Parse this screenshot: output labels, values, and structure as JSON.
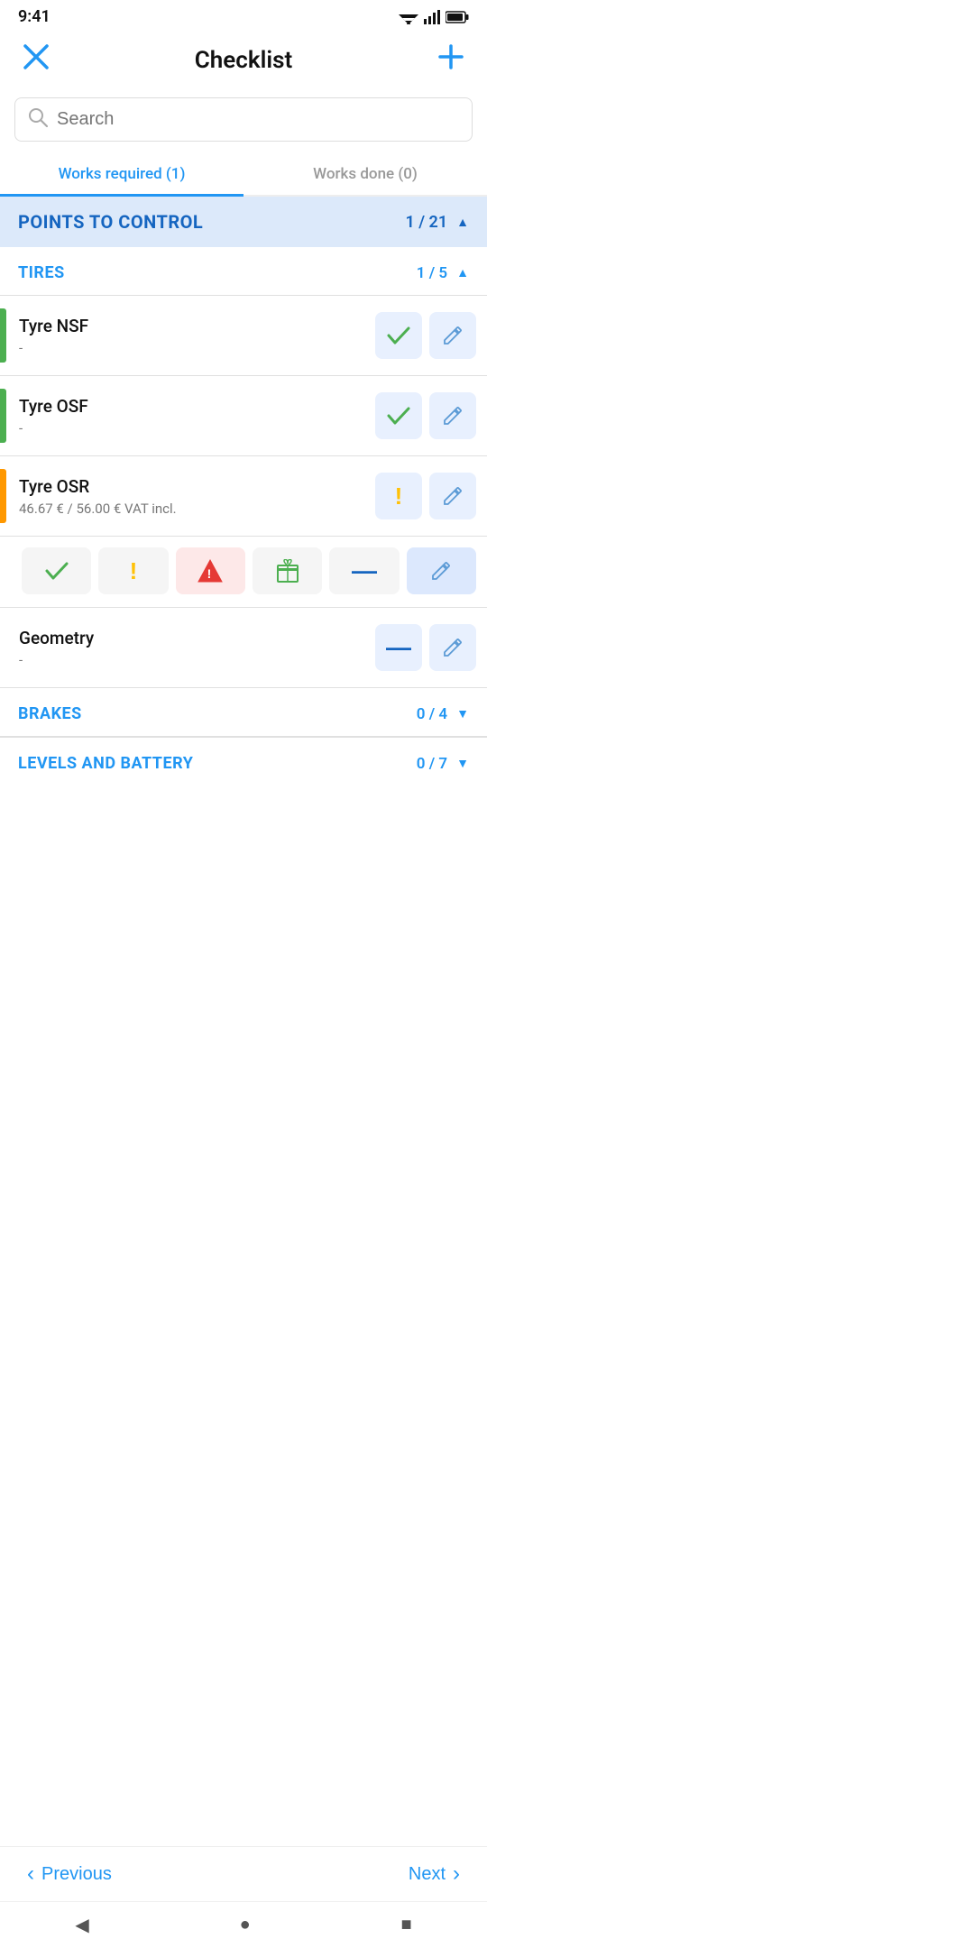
{
  "statusBar": {
    "time": "9:41",
    "wifiIcon": "wifi",
    "signalIcon": "signal",
    "batteryIcon": "battery"
  },
  "header": {
    "closeLabel": "×",
    "title": "Checklist",
    "addLabel": "+"
  },
  "search": {
    "placeholder": "Search"
  },
  "tabs": [
    {
      "label": "Works required (1)",
      "active": true
    },
    {
      "label": "Works done (0)",
      "active": false
    }
  ],
  "pointsToControl": {
    "title": "POINTS TO CONTROL",
    "count": "1 / 21"
  },
  "categories": [
    {
      "id": "tires",
      "title": "TIRES",
      "count": "1 / 5",
      "expanded": true,
      "items": [
        {
          "id": "tyre-nsf",
          "title": "Tyre NSF",
          "subtitle": "-",
          "statusColor": "green",
          "statusType": "check",
          "hasInlineActions": false
        },
        {
          "id": "tyre-osf",
          "title": "Tyre OSF",
          "subtitle": "-",
          "statusColor": "green",
          "statusType": "check",
          "hasInlineActions": false
        },
        {
          "id": "tyre-osr",
          "title": "Tyre OSR",
          "subtitle": "46.67 € / 56.00 € VAT incl.",
          "statusColor": "orange",
          "statusType": "warn",
          "hasInlineActions": true
        },
        {
          "id": "geometry",
          "title": "Geometry",
          "subtitle": "-",
          "statusColor": null,
          "statusType": "dash",
          "hasInlineActions": false
        }
      ]
    },
    {
      "id": "brakes",
      "title": "BRAKES",
      "count": "0 / 4",
      "expanded": false,
      "items": []
    },
    {
      "id": "levels-battery",
      "title": "LEVELS AND BATTERY",
      "count": "0 / 7",
      "expanded": false,
      "items": []
    }
  ],
  "navigation": {
    "previousLabel": "Previous",
    "nextLabel": "Next"
  },
  "systemNav": {
    "backLabel": "◀",
    "homeLabel": "●",
    "recentLabel": "■"
  }
}
